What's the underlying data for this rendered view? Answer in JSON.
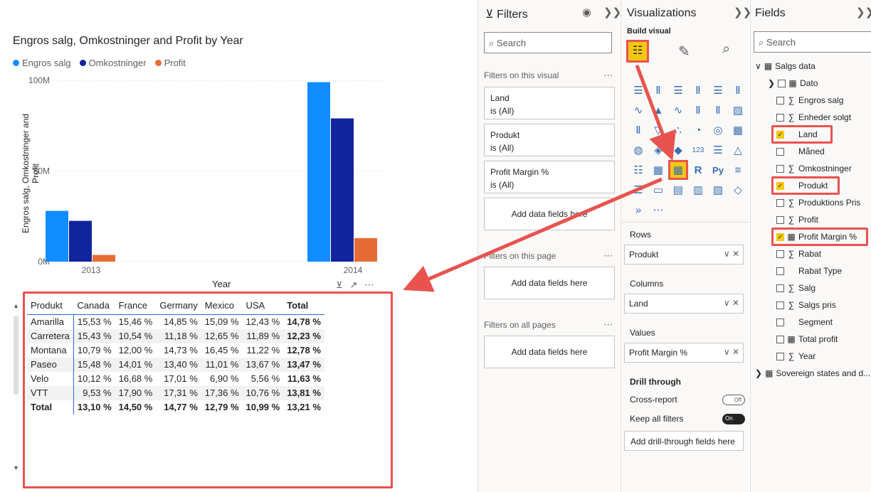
{
  "chart": {
    "title": "Engros salg, Omkostninger and Profit by Year",
    "legend": [
      {
        "name": "Engros salg",
        "color": "#118dff"
      },
      {
        "name": "Omkostninger",
        "color": "#12239e"
      },
      {
        "name": "Profit",
        "color": "#e66c37"
      }
    ],
    "ylabel": "Engros salg, Omkostninger and Profit",
    "xlabel": "Year"
  },
  "chart_data": {
    "type": "bar",
    "title": "Engros salg, Omkostninger and Profit by Year",
    "xlabel": "Year",
    "ylabel": "Engros salg, Omkostninger and Profit",
    "categories": [
      "2013",
      "2014"
    ],
    "series": [
      {
        "name": "Engros salg",
        "values": [
          28,
          99
        ]
      },
      {
        "name": "Omkostninger",
        "values": [
          22.5,
          79
        ]
      },
      {
        "name": "Profit",
        "values": [
          3.7,
          13
        ]
      }
    ],
    "yticks": [
      "0M",
      "50M",
      "100M"
    ],
    "ylim": [
      0,
      100
    ],
    "units": "M"
  },
  "table": {
    "headers": [
      "Produkt",
      "Canada",
      "France",
      "Germany",
      "Mexico",
      "USA",
      "Total"
    ],
    "rows": [
      [
        "Amarilla",
        "15,53 %",
        "15,46 %",
        "14,85 %",
        "15,09 %",
        "12,43 %",
        "14,78 %"
      ],
      [
        "Carretera",
        "15,43 %",
        "10,54 %",
        "11,18 %",
        "12,65 %",
        "11,89 %",
        "12,23 %"
      ],
      [
        "Montana",
        "10,79 %",
        "12,00 %",
        "14,73 %",
        "16,45 %",
        "11,22 %",
        "12,78 %"
      ],
      [
        "Paseo",
        "15,48 %",
        "14,01 %",
        "13,40 %",
        "11,01 %",
        "13,67 %",
        "13,47 %"
      ],
      [
        "Velo",
        "10,12 %",
        "16,68 %",
        "17,01 %",
        "6,90 %",
        "5,56 %",
        "11,63 %"
      ],
      [
        "VTT",
        "9,53 %",
        "17,90 %",
        "17,31 %",
        "17,36 %",
        "10,76 %",
        "13,81 %"
      ]
    ],
    "total": [
      "Total",
      "13,10 %",
      "14,50 %",
      "14,77 %",
      "12,79 %",
      "10,99 %",
      "13,21 %"
    ]
  },
  "filters": {
    "title": "Filters",
    "search_placeholder": "Search",
    "on_visual_label": "Filters on this visual",
    "cards": [
      {
        "name": "Land",
        "value": "is (All)"
      },
      {
        "name": "Produkt",
        "value": "is (All)"
      },
      {
        "name": "Profit Margin %",
        "value": "is (All)"
      }
    ],
    "add_fields": "Add data fields here",
    "on_page_label": "Filters on this page",
    "on_all_label": "Filters on all pages"
  },
  "viz": {
    "title": "Visualizations",
    "build_label": "Build visual",
    "rows_label": "Rows",
    "rows_value": "Produkt",
    "columns_label": "Columns",
    "columns_value": "Land",
    "values_label": "Values",
    "values_value": "Profit Margin %",
    "drill_label": "Drill through",
    "cross_report": "Cross-report",
    "cross_report_state": "Off",
    "keep_filters": "Keep all filters",
    "keep_filters_state": "On",
    "add_drill": "Add drill-through fields here"
  },
  "fields": {
    "title": "Fields",
    "search_placeholder": "Search",
    "table_name": "Salgs data",
    "items": [
      {
        "label": "Dato",
        "checked": false
      },
      {
        "label": "Engros salg",
        "checked": false
      },
      {
        "label": "Enheder solgt",
        "checked": false
      },
      {
        "label": "Land",
        "checked": true
      },
      {
        "label": "Måned",
        "checked": false
      },
      {
        "label": "Omkostninger",
        "checked": false
      },
      {
        "label": "Produkt",
        "checked": true
      },
      {
        "label": "Produktions Pris",
        "checked": false
      },
      {
        "label": "Profit",
        "checked": false
      },
      {
        "label": "Profit Margin %",
        "checked": true
      },
      {
        "label": "Rabat",
        "checked": false
      },
      {
        "label": "Rabat Type",
        "checked": false
      },
      {
        "label": "Salg",
        "checked": false
      },
      {
        "label": "Salgs pris",
        "checked": false
      },
      {
        "label": "Segment",
        "checked": false
      },
      {
        "label": "Total profit",
        "checked": false
      },
      {
        "label": "Year",
        "checked": false
      }
    ],
    "other_table": "Sovereign states and d..."
  }
}
